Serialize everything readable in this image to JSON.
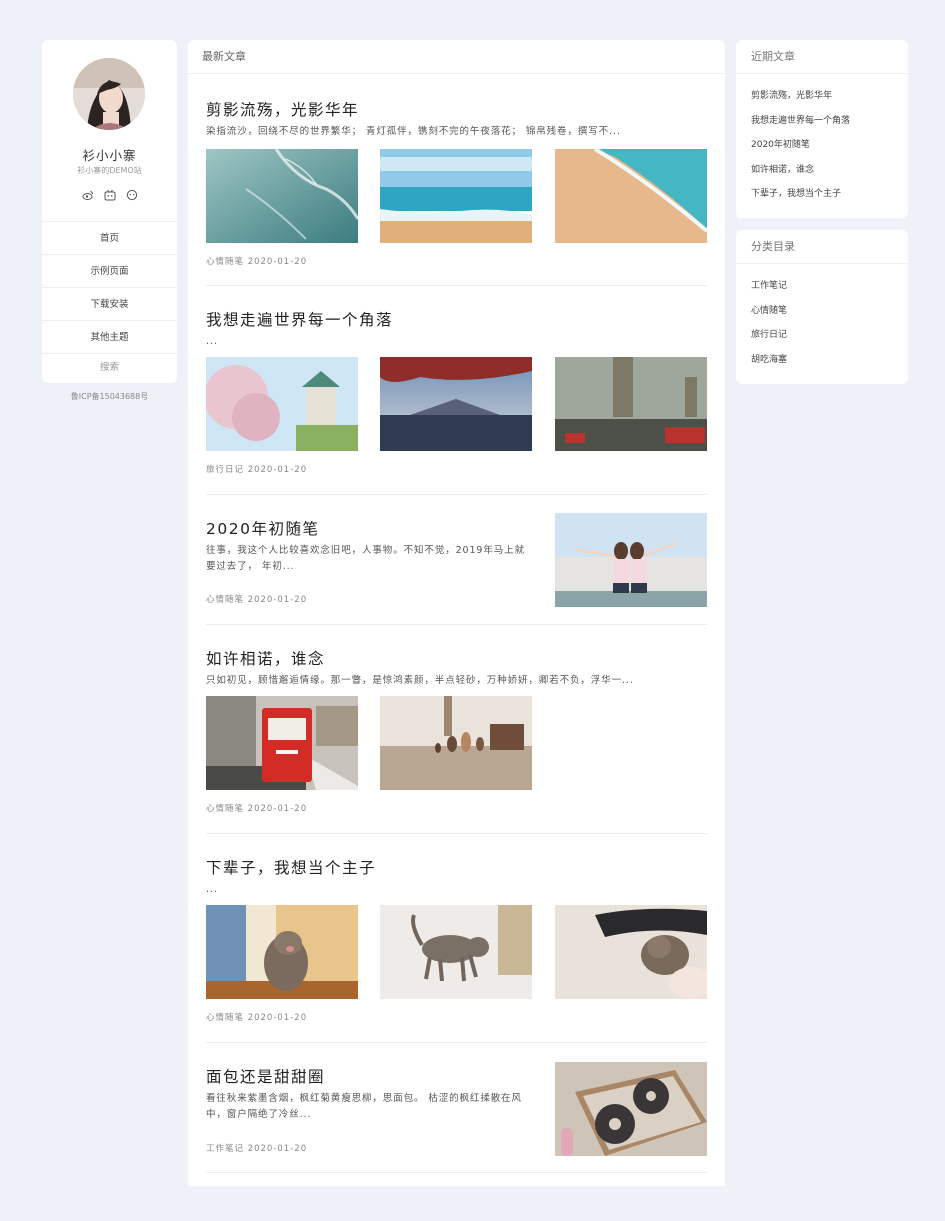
{
  "profile": {
    "name": "衫小小寨",
    "description": "衫小寨的DEMO站",
    "social_icons": [
      "weibo-icon",
      "bilibili-icon",
      "zhihu-icon"
    ],
    "menu": [
      "首页",
      "示例页面",
      "下载安装",
      "其他主题"
    ],
    "search_label": "搜索"
  },
  "icp": "鲁ICP备15043688号",
  "main": {
    "header": "最新文章",
    "posts": [
      {
        "title": "剪影流殇，光影华年",
        "excerpt": "染指流沙，回绕不尽的世界繁华；  青灯孤伴，镌刻不完的午夜落花；  锦帛残卷，撰写不...",
        "meta": "心情随笔 2020-01-20",
        "images": [
          "waves-photo",
          "beach-photo",
          "shore-photo"
        ]
      },
      {
        "title": "我想走遍世界每一个角落",
        "excerpt": "...",
        "meta": "旅行日记 2020-01-20",
        "images": [
          "castle-sakura-photo",
          "mount-fuji-photo",
          "rainy-london-photo"
        ]
      },
      {
        "title": "2020年初随笔",
        "excerpt": "往事，我这个人比较喜欢念旧吧，人事物。不知不觉，2019年马上就要过去了，  年初...",
        "meta": "心情随笔 2020-01-20",
        "images": [
          "friends-photo"
        ]
      },
      {
        "title": "如许相诺，谁念",
        "excerpt": "只如初见，顾惜邂逅情缘。那一瞥，是惊鸿素颜，半点轻砂，万种娇妍，卿若不负，浮华一...",
        "meta": "心情随笔 2020-01-20",
        "images": [
          "post-box-photo",
          "figurines-photo"
        ]
      },
      {
        "title": "下辈子，我想当个主子",
        "excerpt": "...",
        "meta": "心情随笔 2020-01-20",
        "images": [
          "kitten-yawn-photo",
          "kitten-walk-photo",
          "kitten-hide-photo"
        ]
      },
      {
        "title": "面包还是甜甜圈",
        "excerpt": "看往秋来紫墨含烟，枫红菊黄瘦思柳，思面包。  枯涩的枫红揉散在风中，窗户隔绝了冷丝...",
        "meta": "工作笔记 2020-01-20",
        "images": [
          "donuts-photo"
        ]
      }
    ]
  },
  "recent": {
    "title": "近期文章",
    "items": [
      "剪影流殇，光影华年",
      "我想走遍世界每一个角落",
      "2020年初随笔",
      "如许相诺，谁念",
      "下辈子，我想当个主子"
    ]
  },
  "categories": {
    "title": "分类目录",
    "items": [
      "工作笔记",
      "心情随笔",
      "旅行日记",
      "胡吃海塞"
    ]
  }
}
